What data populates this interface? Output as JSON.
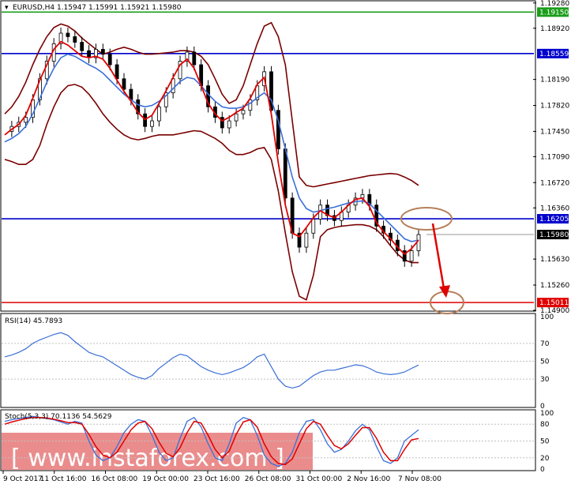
{
  "header": {
    "symbol_line": "EURUSD,H4  1.15947 1.15991 1.15921 1.15980",
    "rsi_label": "RSI(14) 45.7893",
    "stoch_label": "Stoch(5,3,3) 70.1136 54.5629"
  },
  "watermark": {
    "text": "[ www.instaforex.com ]"
  },
  "colors": {
    "up_level": "#1a9e1a",
    "resistance": "#0000cc",
    "support": "#e00000",
    "bollinger": "#7a0000",
    "ma_fast": "#e00000",
    "ma_slow": "#3a6fd8",
    "candles": "#000000",
    "rsi_line": "#3a6fd8",
    "annotation": "#b5805a",
    "watermark_band": "#e87878"
  },
  "chart_data": [
    {
      "type": "candlestick",
      "title": "EURUSD,H4",
      "ohlc_last": {
        "open": 1.15947,
        "high": 1.15991,
        "low": 1.15921,
        "close": 1.1598
      },
      "ylim": [
        1.149,
        1.193
      ],
      "y_ticks": [
        "1.19280",
        "1.18920",
        "1.18190",
        "1.17820",
        "1.17450",
        "1.17090",
        "1.16720",
        "1.16360",
        "1.15630",
        "1.15260",
        "1.14900"
      ],
      "x_tick_labels": [
        "9 Oct 2017",
        "11 Oct 16:00",
        "16 Oct 08:00",
        "19 Oct 00:00",
        "23 Oct 16:00",
        "26 Oct 08:00",
        "31 Oct 00:00",
        "2 Nov 16:00",
        "7 Nov 08:00"
      ],
      "levels": [
        {
          "value": 1.1915,
          "label": "1.19150",
          "color": "#1a9e1a"
        },
        {
          "value": 1.18559,
          "label": "1.18559",
          "color": "#0000cc"
        },
        {
          "value": 1.16205,
          "label": "1.16205",
          "color": "#0000cc"
        },
        {
          "value": 1.1598,
          "label": "1.15980",
          "color": "#000000"
        },
        {
          "value": 1.15011,
          "label": "1.15011",
          "color": "#e00000"
        }
      ],
      "close_path": [
        1.1745,
        1.1752,
        1.1758,
        1.1765,
        1.179,
        1.182,
        1.1845,
        1.187,
        1.1885,
        1.188,
        1.1872,
        1.186,
        1.185,
        1.1862,
        1.1855,
        1.184,
        1.182,
        1.1805,
        1.179,
        1.177,
        1.1752,
        1.176,
        1.178,
        1.18,
        1.182,
        1.1845,
        1.1858,
        1.184,
        1.181,
        1.178,
        1.1765,
        1.175,
        1.176,
        1.177,
        1.1775,
        1.179,
        1.181,
        1.183,
        1.1775,
        1.172,
        1.165,
        1.16,
        1.158,
        1.16,
        1.162,
        1.164,
        1.1625,
        1.1618,
        1.163,
        1.164,
        1.165,
        1.1655,
        1.164,
        1.161,
        1.16,
        1.159,
        1.1575,
        1.156,
        1.1575,
        1.1598
      ],
      "ma_fast": [
        1.174,
        1.1748,
        1.1755,
        1.1768,
        1.1792,
        1.1818,
        1.184,
        1.1862,
        1.1873,
        1.1868,
        1.186,
        1.1852,
        1.185,
        1.1852,
        1.1848,
        1.1835,
        1.1818,
        1.1802,
        1.1788,
        1.1772,
        1.1762,
        1.1768,
        1.1785,
        1.1803,
        1.1822,
        1.184,
        1.1848,
        1.1835,
        1.181,
        1.1785,
        1.177,
        1.176,
        1.1765,
        1.1772,
        1.1778,
        1.1792,
        1.1812,
        1.1822,
        1.177,
        1.17,
        1.164,
        1.16,
        1.1595,
        1.1608,
        1.1622,
        1.1632,
        1.1626,
        1.1622,
        1.163,
        1.164,
        1.1648,
        1.165,
        1.1638,
        1.1615,
        1.1602,
        1.1592,
        1.158,
        1.157,
        1.1578,
        1.159
      ],
      "ma_slow": [
        1.173,
        1.1735,
        1.1742,
        1.1752,
        1.177,
        1.1792,
        1.1815,
        1.1835,
        1.185,
        1.1855,
        1.1852,
        1.1846,
        1.184,
        1.1835,
        1.1828,
        1.1818,
        1.1808,
        1.1798,
        1.179,
        1.1783,
        1.178,
        1.1782,
        1.1788,
        1.1796,
        1.1806,
        1.1816,
        1.1822,
        1.182,
        1.181,
        1.1798,
        1.1788,
        1.178,
        1.1778,
        1.1778,
        1.178,
        1.1785,
        1.1793,
        1.18,
        1.179,
        1.176,
        1.172,
        1.168,
        1.165,
        1.1635,
        1.163,
        1.1632,
        1.1635,
        1.1637,
        1.164,
        1.1643,
        1.1645,
        1.1646,
        1.1642,
        1.1632,
        1.1622,
        1.1612,
        1.1602,
        1.1592,
        1.1588,
        1.159
      ],
      "bb_upper": [
        1.177,
        1.178,
        1.1795,
        1.1815,
        1.184,
        1.1862,
        1.188,
        1.1893,
        1.1898,
        1.1895,
        1.1888,
        1.1878,
        1.187,
        1.1862,
        1.1855,
        1.1858,
        1.1862,
        1.1865,
        1.1862,
        1.1858,
        1.1855,
        1.1855,
        1.1856,
        1.1857,
        1.1858,
        1.186,
        1.186,
        1.1858,
        1.1852,
        1.184,
        1.182,
        1.1798,
        1.1785,
        1.179,
        1.181,
        1.184,
        1.187,
        1.1895,
        1.19,
        1.188,
        1.184,
        1.176,
        1.168,
        1.1668,
        1.1666,
        1.1668,
        1.167,
        1.1672,
        1.1674,
        1.1676,
        1.1678,
        1.168,
        1.1682,
        1.1683,
        1.1684,
        1.1685,
        1.1684,
        1.168,
        1.1675,
        1.1668
      ],
      "bb_lower": [
        1.1705,
        1.1702,
        1.1698,
        1.1698,
        1.1705,
        1.1725,
        1.1755,
        1.178,
        1.18,
        1.181,
        1.1812,
        1.1808,
        1.1798,
        1.1785,
        1.177,
        1.1758,
        1.1748,
        1.174,
        1.1735,
        1.1733,
        1.1735,
        1.1738,
        1.174,
        1.174,
        1.174,
        1.1742,
        1.1744,
        1.1746,
        1.1745,
        1.174,
        1.1735,
        1.1728,
        1.1718,
        1.1712,
        1.1712,
        1.1715,
        1.172,
        1.1722,
        1.1705,
        1.166,
        1.16,
        1.1545,
        1.151,
        1.1505,
        1.154,
        1.1595,
        1.1605,
        1.1608,
        1.161,
        1.1611,
        1.1612,
        1.1612,
        1.161,
        1.1605,
        1.1595,
        1.1582,
        1.157,
        1.1562,
        1.1558,
        1.1558
      ]
    },
    {
      "type": "line",
      "title": "RSI(14) 45.7893",
      "ylim": [
        0,
        100
      ],
      "y_ticks": [
        "100",
        "70",
        "50",
        "30",
        "0"
      ],
      "series": [
        {
          "name": "RSI(14)",
          "values": [
            55,
            57,
            60,
            64,
            70,
            74,
            77,
            80,
            82,
            79,
            72,
            66,
            60,
            57,
            55,
            50,
            45,
            40,
            35,
            32,
            30,
            34,
            42,
            48,
            54,
            58,
            56,
            50,
            44,
            40,
            37,
            35,
            37,
            40,
            43,
            48,
            55,
            58,
            44,
            30,
            22,
            20,
            22,
            28,
            34,
            38,
            40,
            40,
            42,
            44,
            46,
            45,
            42,
            38,
            36,
            35,
            36,
            38,
            42,
            45.79
          ]
        }
      ]
    },
    {
      "type": "line",
      "title": "Stoch(5,3,3) 70.1136 54.5629",
      "ylim": [
        0,
        100
      ],
      "y_ticks": [
        "100",
        "80",
        "50",
        "20",
        "0"
      ],
      "series": [
        {
          "name": "Main",
          "values": [
            85,
            88,
            90,
            92,
            94,
            92,
            90,
            88,
            84,
            80,
            85,
            82,
            50,
            25,
            15,
            20,
            40,
            65,
            80,
            88,
            85,
            60,
            30,
            15,
            20,
            55,
            85,
            92,
            75,
            45,
            20,
            15,
            45,
            82,
            92,
            88,
            60,
            25,
            10,
            5,
            10,
            30,
            65,
            85,
            88,
            70,
            45,
            30,
            35,
            50,
            68,
            80,
            70,
            40,
            15,
            10,
            20,
            50,
            60,
            70.11
          ]
        },
        {
          "name": "Signal",
          "values": [
            80,
            84,
            87,
            90,
            92,
            92,
            91,
            89,
            86,
            83,
            83,
            80,
            62,
            40,
            25,
            20,
            30,
            50,
            70,
            82,
            85,
            72,
            48,
            28,
            22,
            38,
            65,
            85,
            82,
            60,
            35,
            20,
            32,
            62,
            84,
            88,
            75,
            45,
            22,
            10,
            8,
            18,
            45,
            72,
            85,
            80,
            60,
            42,
            36,
            45,
            60,
            74,
            74,
            55,
            30,
            15,
            15,
            35,
            52,
            54.56
          ]
        }
      ]
    }
  ]
}
